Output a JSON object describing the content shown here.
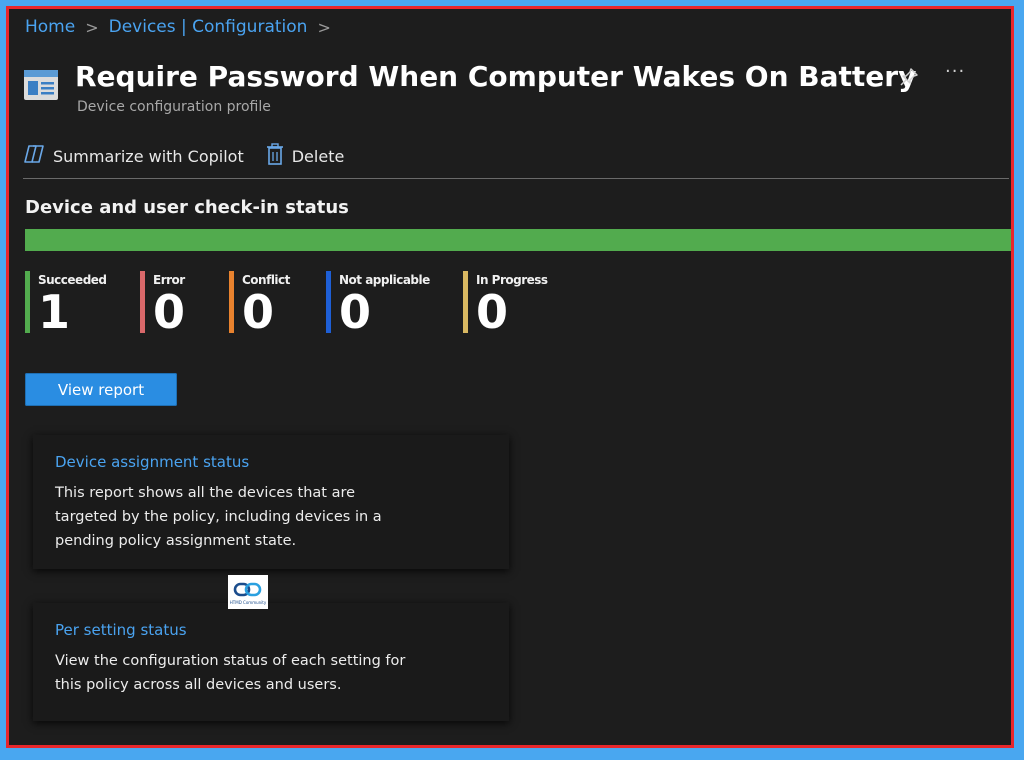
{
  "breadcrumb": {
    "home": "Home",
    "devices": "Devices | Configuration"
  },
  "header": {
    "title": "Require Password When Computer Wakes On Battery",
    "subtitle": "Device configuration profile",
    "more": "···"
  },
  "toolbar": {
    "copilot_label": "Summarize with Copilot",
    "delete_label": "Delete"
  },
  "status": {
    "title": "Device and user check-in status",
    "progress_succeeded_fraction": 1.0,
    "stats": [
      {
        "label": "Succeeded",
        "value": "1",
        "color": "#52ab4e"
      },
      {
        "label": "Error",
        "value": "0",
        "color": "#d9686a"
      },
      {
        "label": "Conflict",
        "value": "0",
        "color": "#e8822e"
      },
      {
        "label": "Not applicable",
        "value": "0",
        "color": "#1e5fd6"
      },
      {
        "label": "In Progress",
        "value": "0",
        "color": "#d9b862"
      }
    ]
  },
  "view_report_label": "View report",
  "cards": [
    {
      "title": "Device assignment status",
      "description": "This report shows all the devices that are targeted by the policy, including devices in a pending policy assignment state."
    },
    {
      "title": "Per setting status",
      "description": "View the configuration status of each setting for this policy across all devices and users."
    }
  ],
  "logo": {
    "watermark": "HTMD Community"
  },
  "colors": {
    "accent": "#4aa3f0",
    "button": "#2a8de2",
    "frame": "#e8262b",
    "background": "#1d1d1d"
  }
}
